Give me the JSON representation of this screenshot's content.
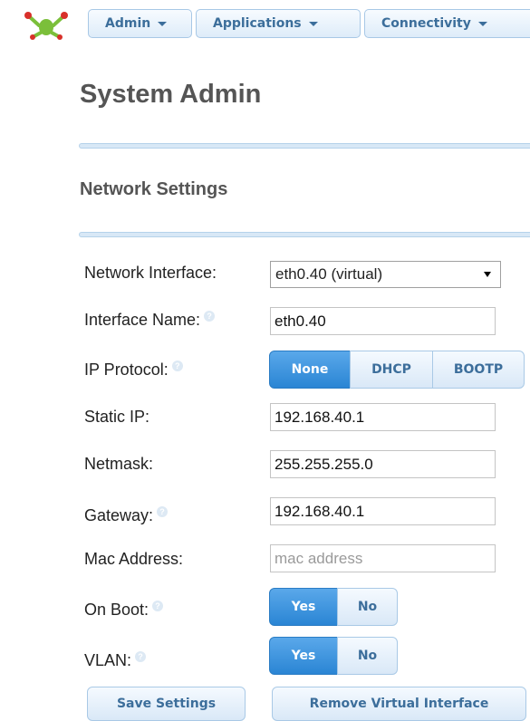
{
  "nav": {
    "logo_icon": "frog-logo-icon",
    "items": [
      {
        "label": "Admin"
      },
      {
        "label": "Applications"
      },
      {
        "label": "Connectivity"
      }
    ]
  },
  "page_title": "System Admin",
  "section_title": "Network Settings",
  "form": {
    "network_interface": {
      "label": "Network Interface:",
      "value": "eth0.40 (virtual)"
    },
    "interface_name": {
      "label": "Interface Name:",
      "value": "eth0.40"
    },
    "ip_protocol": {
      "label": "IP Protocol:",
      "options": [
        "None",
        "DHCP",
        "BOOTP"
      ],
      "selected": "None"
    },
    "static_ip": {
      "label": "Static IP:",
      "value": "192.168.40.1"
    },
    "netmask": {
      "label": "Netmask:",
      "value": "255.255.255.0"
    },
    "gateway": {
      "label": "Gateway:",
      "value": "192.168.40.1"
    },
    "mac_address": {
      "label": "Mac Address:",
      "value": "",
      "placeholder": "mac address"
    },
    "on_boot": {
      "label": "On Boot:",
      "options": [
        "Yes",
        "No"
      ],
      "selected": "Yes"
    },
    "vlan": {
      "label": "VLAN:",
      "options": [
        "Yes",
        "No"
      ],
      "selected": "Yes"
    }
  },
  "buttons": {
    "save": "Save Settings",
    "remove": "Remove Virtual Interface"
  },
  "colors": {
    "accent": "#2a85d4",
    "button_text": "#3c6e9b",
    "divider": "#d8e8f6"
  }
}
